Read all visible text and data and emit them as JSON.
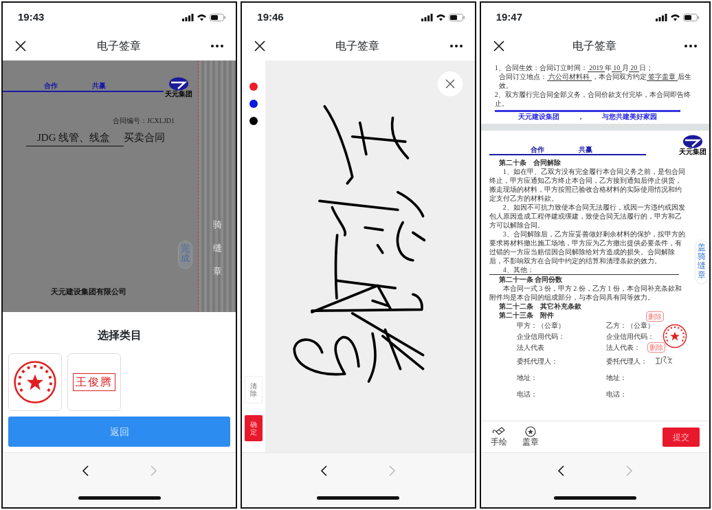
{
  "screens": [
    {
      "kind": "stamp_picker",
      "time": "19:43",
      "title": "电子签章",
      "document": {
        "brand_left": "合作",
        "brand_right": "共赢",
        "logo_text": "天元集团",
        "contract_no": "合同编号：JCXLJD1",
        "title_blank": "JDG 线管、线盒",
        "title": "买卖合同",
        "company": "天元建设集团有限公司"
      },
      "done_button": "完成",
      "seam_label": "骑缝章",
      "sheet": {
        "title": "选择类目",
        "stamps": [
          {
            "kind": "seal"
          },
          {
            "kind": "name",
            "text": "王俊腾"
          }
        ],
        "return_button": "返回"
      },
      "nav": {
        "back_disabled": false,
        "forward_disabled": true
      }
    },
    {
      "kind": "signature_pad",
      "time": "19:46",
      "title": "电子签章",
      "pen_colors": [
        {
          "color": "#ee1c25"
        },
        {
          "color": "#0a1ae0"
        },
        {
          "color": "#000000"
        }
      ],
      "clear_button": "清除",
      "confirm_button": "确定",
      "nav": {
        "back_disabled": false,
        "forward_disabled": true
      }
    },
    {
      "kind": "document_view",
      "time": "19:47",
      "title": "电子签章",
      "prev_page": {
        "lines": [
          [
            {
              "text": "1、合同生效：合同订立时间：",
              "underlined": false
            },
            {
              "text": " 2019 ",
              "underlined": true
            },
            {
              "text": "年",
              "underlined": false
            },
            {
              "text": " 10 ",
              "underlined": true
            },
            {
              "text": "月",
              "underlined": false
            },
            {
              "text": " 20 ",
              "underlined": true
            },
            {
              "text": "日；",
              "underlined": false
            }
          ],
          [
            {
              "text": "合同订立地点：",
              "underlined": false
            },
            {
              "text": "  六公司材料科  ",
              "underlined": true
            },
            {
              "text": "，本合同双方约定",
              "underlined": false
            },
            {
              "text": "  签字盖章  ",
              "underlined": true
            },
            {
              "text": "后生效。",
              "underlined": false
            }
          ],
          [
            {
              "text": "2、双方履行完合同全部义务，合同价款支付完毕，本合同即告终止。",
              "underlined": false
            }
          ]
        ],
        "footer": [
          "天元建设集团",
          "，",
          "与您共建美好家园"
        ]
      },
      "page": {
        "brand_left": "合作",
        "brand_right": "共赢",
        "logo_text": "天元集团",
        "sections": [
          {
            "kind": "heading",
            "text": "第二十条　合同解除"
          },
          {
            "kind": "para",
            "text": "1、如在甲、乙双方没有完全履行本合同义务之前，是包合同终止，甲方应通知乙方终止本合同，乙方接到通知后停止供货，搬走现场的材料，甲方按照已验收合格材料的实际使用情况和约定支付乙方的材料款。"
          },
          {
            "kind": "para",
            "text": "2、如因不可抗力致使本合同无法履行，或因一方违约或因发包人原因造成工程停建或缓建，致使合同无法履行的，甲方和乙方可以解除合同。"
          },
          {
            "kind": "para",
            "text": "3、合同解除后，乙方应妥善做好剩余材料的保护，按甲方的要求将材料撤出施工场地，甲方应为乙方撤出提供必要条件，有过错的一方应当赔偿因合同解除给对方造成的损失。合同解除后，不影响双方在合同中约定的结算和清理条款的效力。"
          },
          {
            "kind": "blank_line",
            "text": "4、其他："
          },
          {
            "kind": "heading",
            "text": "第二十一条 合同份数"
          },
          {
            "kind": "para",
            "text": "本合同一式 3 份，甲方 2 份，乙方 1 份，本合同补充条款和附件均是本合同的组成部分，与本合同具有同等效力。"
          },
          {
            "kind": "heading",
            "text": "第二十二条　其它补充条款"
          },
          {
            "kind": "heading",
            "text": "第二十三条　附件"
          }
        ],
        "signatures": [
          {
            "left": "甲方：（公章）",
            "right": "乙方：（公章）"
          },
          {
            "left": "企业信用代码：",
            "right": "企业信用代码："
          },
          {
            "left": "法人代表",
            "right": "法人代表："
          },
          {
            "left": "委托代理人：",
            "right": "委托代理人："
          },
          {
            "left": "地址：",
            "right": "地址："
          },
          {
            "left": "电话：",
            "right": "电话："
          }
        ],
        "delete_labels": [
          "删除",
          "删除"
        ]
      },
      "seam_button": "盖骑缝章",
      "tools": [
        {
          "kind": "pen",
          "label": "手绘"
        },
        {
          "kind": "seal",
          "label": "盖章"
        }
      ],
      "submit_button": "提交",
      "nav": {
        "back_disabled": false,
        "forward_disabled": true
      }
    }
  ]
}
